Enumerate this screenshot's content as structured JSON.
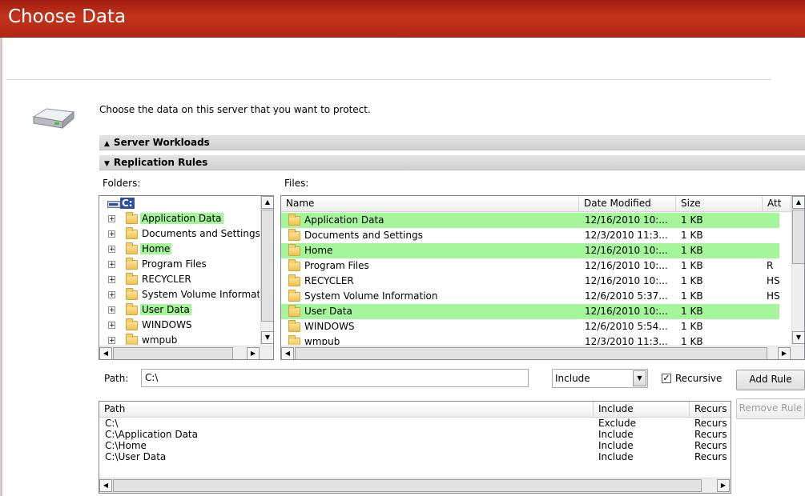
{
  "window": {
    "title": "Choose Data"
  },
  "intro": "Choose the data on this server that you want to protect.",
  "sections": {
    "server_workloads": "Server Workloads",
    "replication_rules": "Replication Rules"
  },
  "labels": {
    "folders": "Folders:",
    "files": "Files:",
    "path": "Path:"
  },
  "tree": {
    "root": "C:",
    "items": [
      {
        "label": "Application Data",
        "highlighted": true
      },
      {
        "label": "Documents and Settings",
        "highlighted": false
      },
      {
        "label": "Home",
        "highlighted": true
      },
      {
        "label": "Program Files",
        "highlighted": false
      },
      {
        "label": "RECYCLER",
        "highlighted": false
      },
      {
        "label": "System Volume Informat",
        "highlighted": false
      },
      {
        "label": "User Data",
        "highlighted": true
      },
      {
        "label": "WINDOWS",
        "highlighted": false
      },
      {
        "label": "wmpub",
        "highlighted": false
      }
    ]
  },
  "files": {
    "columns": {
      "name": "Name",
      "date": "Date Modified",
      "size": "Size",
      "attr": "Att"
    },
    "rows": [
      {
        "name": "Application Data",
        "date": "12/16/2010 10:...",
        "size": "1 KB",
        "attr": "",
        "highlighted": true
      },
      {
        "name": "Documents and Settings",
        "date": "12/3/2010 11:3...",
        "size": "1 KB",
        "attr": "",
        "highlighted": false
      },
      {
        "name": "Home",
        "date": "12/16/2010 10:...",
        "size": "1 KB",
        "attr": "",
        "highlighted": true
      },
      {
        "name": "Program Files",
        "date": "12/16/2010 10:...",
        "size": "1 KB",
        "attr": "R",
        "highlighted": false
      },
      {
        "name": "RECYCLER",
        "date": "12/16/2010 10:...",
        "size": "1 KB",
        "attr": "HS",
        "highlighted": false
      },
      {
        "name": "System Volume Information",
        "date": "12/6/2010 5:37...",
        "size": "1 KB",
        "attr": "HS",
        "highlighted": false
      },
      {
        "name": "User Data",
        "date": "12/16/2010 10:...",
        "size": "1 KB",
        "attr": "",
        "highlighted": true
      },
      {
        "name": "WINDOWS",
        "date": "12/6/2010 5:54...",
        "size": "1 KB",
        "attr": "",
        "highlighted": false
      },
      {
        "name": "wmpub",
        "date": "12/3/2010 11:3...",
        "size": "1 KB",
        "attr": "",
        "highlighted": false
      }
    ]
  },
  "path": {
    "value": "C:\\",
    "mode": "Include",
    "recursive_label": "Recursive",
    "recursive_checked": true
  },
  "buttons": {
    "add_rule": "Add Rule",
    "remove_rule": "Remove Rule"
  },
  "rules": {
    "columns": {
      "path": "Path",
      "include": "Include",
      "recursive": "Recurs"
    },
    "rows": [
      {
        "path": "C:\\",
        "include": "Exclude",
        "recursive": "Recurs"
      },
      {
        "path": "C:\\Application Data",
        "include": "Include",
        "recursive": "Recurs"
      },
      {
        "path": "C:\\Home",
        "include": "Include",
        "recursive": "Recurs"
      },
      {
        "path": "C:\\User Data",
        "include": "Include",
        "recursive": "Recurs"
      }
    ]
  },
  "colors": {
    "title_bar": "#b32614",
    "highlight": "#a5f59a"
  },
  "icons": {
    "disk": "hard-drive-icon",
    "folder": "folder-icon",
    "expand": "plus-box-icon",
    "section_collapsed": "triangle-up-icon",
    "section_expanded": "triangle-down-icon",
    "checkbox": "checkmark-icon"
  }
}
